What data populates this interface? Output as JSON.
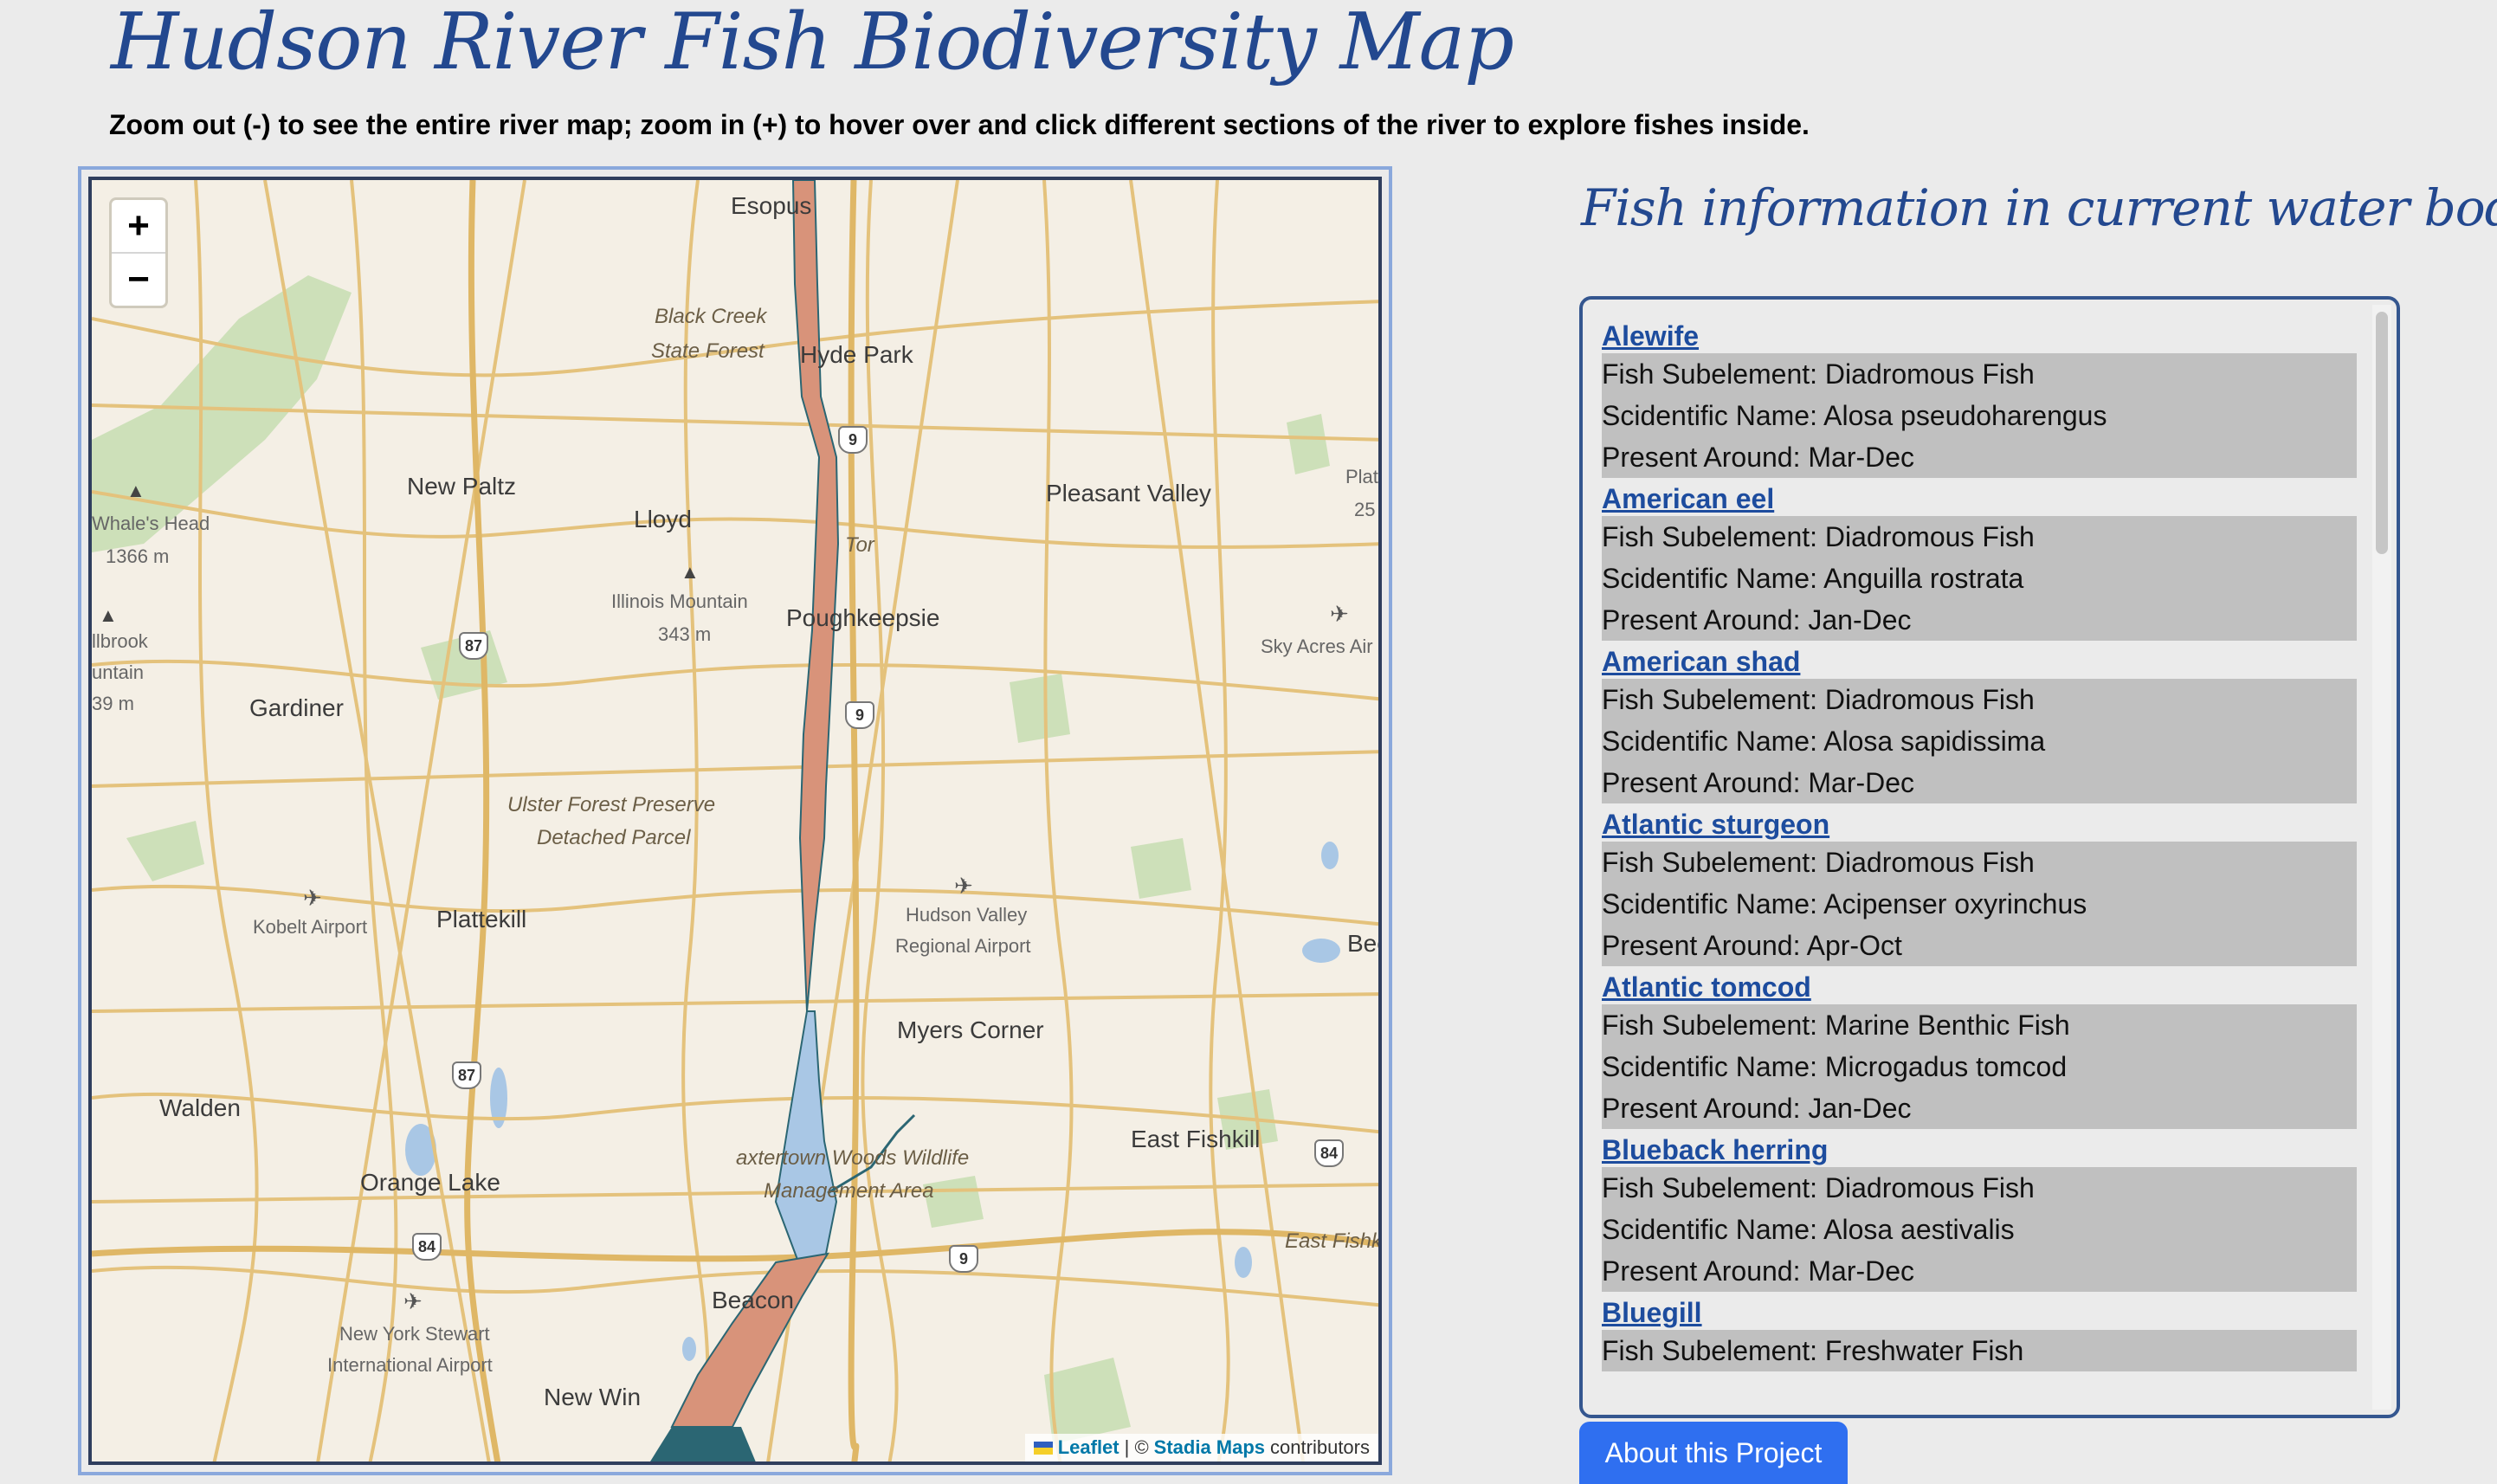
{
  "page": {
    "title": "Hudson River Fish Biodiversity Map",
    "instructions": "Zoom out (-) to see the entire river map; zoom in (+) to hover over and click different sections of the river to explore fishes inside."
  },
  "map": {
    "zoom_in": "+",
    "zoom_out": "−",
    "attribution": {
      "leaflet": "Leaflet",
      "separator": "| ©",
      "stadia": "Stadia Maps",
      "suffix": "contributors"
    },
    "labels": {
      "esopus": "Esopus",
      "hyde_park": "Hyde Park",
      "black_creek_1": "Black Creek",
      "black_creek_2": "State Forest",
      "new_paltz": "New Paltz",
      "lloyd": "Lloyd",
      "pleasant_valley": "Pleasant Valley",
      "plat": "Plat",
      "plat_elev": "25",
      "whales_head": "Whale's Head",
      "whales_head_elev": "1366 m",
      "illinois_mountain": "Illinois Mountain",
      "illinois_elev": "343 m",
      "poughkeepsie": "Poughkeepsie",
      "tor": "Tor",
      "sky_acres": "Sky Acres Air",
      "brook": "llbrook",
      "untain": "untain",
      "brook_elev": "39 m",
      "gardiner": "Gardiner",
      "ulster_1": "Ulster Forest Preserve",
      "ulster_2": "Detached Parcel",
      "plattekill": "Plattekill",
      "kobelt": "Kobelt Airport",
      "hv_airport_1": "Hudson Valley",
      "hv_airport_2": "Regional Airport",
      "bee": "Bee",
      "myers_corner": "Myers Corner",
      "walden": "Walden",
      "east_fishkill": "East Fishkill",
      "baxtertown_1": "axtertown Woods Wildlife",
      "baxtertown_2": "Management Area",
      "orange_lake": "Orange Lake",
      "east_fishki_2": "East Fishki",
      "beacon": "Beacon",
      "ny_stewart_1": "New York Stewart",
      "ny_stewart_2": "International Airport",
      "new_windsor": "New Win"
    },
    "shields": {
      "s1": "9",
      "s2": "9",
      "s3": "9",
      "s4": "87",
      "s5": "87",
      "s6": "84",
      "s7": "84"
    },
    "colors": {
      "river_orange": "#d8937a",
      "river_blue": "#a9c7e5",
      "river_teal": "#2b6673",
      "land": "#f4efe5",
      "road": "#e8c77e",
      "park": "#c6dcb1"
    }
  },
  "info": {
    "title": "Fish information in current water body",
    "fish": [
      {
        "name": "Alewife",
        "subelement": "Fish Subelement: Diadromous Fish",
        "scientific": "Scidentific Name: Alosa pseudoharengus",
        "present": "Present Around: Mar-Dec"
      },
      {
        "name": "American eel",
        "subelement": "Fish Subelement: Diadromous Fish",
        "scientific": "Scidentific Name: Anguilla rostrata",
        "present": "Present Around: Jan-Dec"
      },
      {
        "name": "American shad",
        "subelement": "Fish Subelement: Diadromous Fish",
        "scientific": "Scidentific Name: Alosa sapidissima",
        "present": "Present Around: Mar-Dec"
      },
      {
        "name": "Atlantic sturgeon",
        "subelement": "Fish Subelement: Diadromous Fish",
        "scientific": "Scidentific Name: Acipenser oxyrinchus",
        "present": "Present Around: Apr-Oct"
      },
      {
        "name": "Atlantic tomcod",
        "subelement": "Fish Subelement: Marine Benthic Fish",
        "scientific": "Scidentific Name: Microgadus tomcod",
        "present": "Present Around: Jan-Dec"
      },
      {
        "name": "Blueback herring",
        "subelement": "Fish Subelement: Diadromous Fish",
        "scientific": "Scidentific Name: Alosa aestivalis",
        "present": "Present Around: Mar-Dec"
      },
      {
        "name": "Bluegill",
        "subelement": "Fish Subelement: Freshwater Fish",
        "scientific": "",
        "present": ""
      }
    ]
  },
  "about_button": "About this Project"
}
